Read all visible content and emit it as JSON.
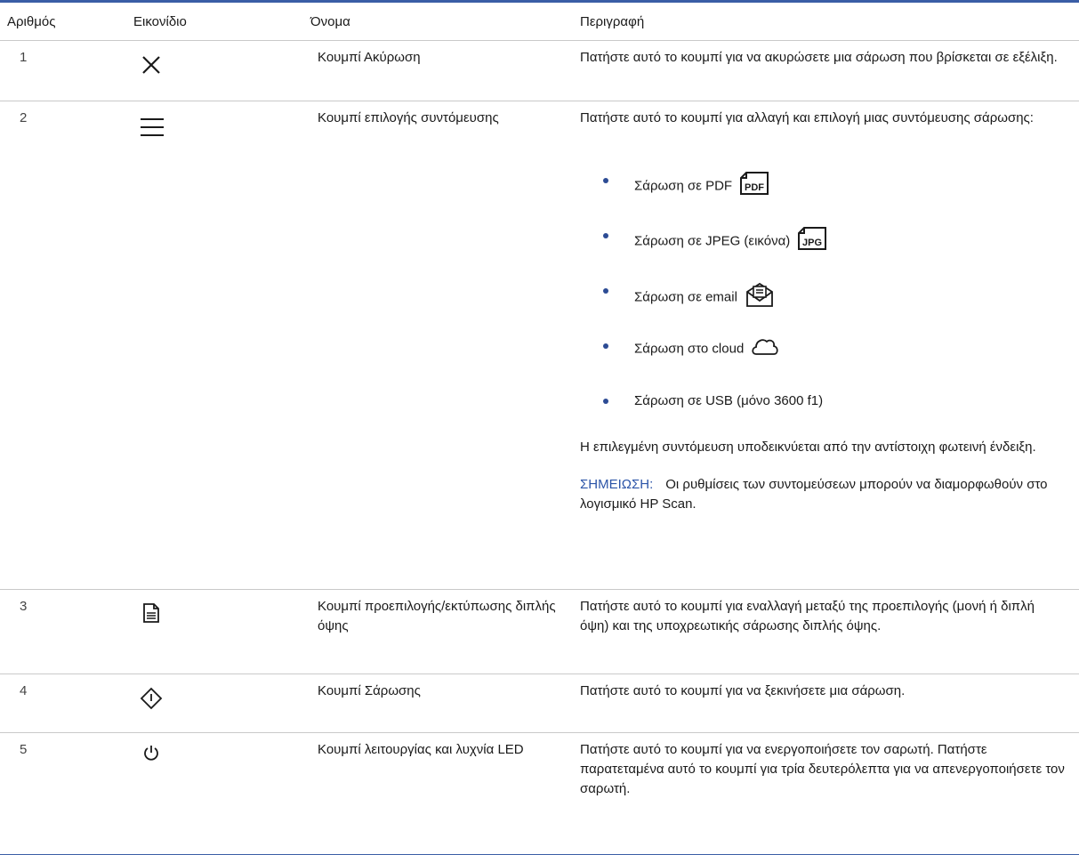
{
  "table": {
    "headers": {
      "number": "Αριθμός",
      "icon": "Εικονίδιο",
      "name": "Όνομα",
      "description": "Περιγραφή"
    },
    "rows": [
      {
        "number": "1",
        "icon": "close-icon",
        "name": "Κουμπί Ακύρωση",
        "description": "Πατήστε αυτό το κουμπί για να ακυρώσετε μια σάρωση που βρίσκεται σε εξέλιξη."
      },
      {
        "number": "2",
        "icon": "menu-icon",
        "name": "Κουμπί επιλογής συντόμευσης",
        "description": "Πατήστε αυτό το κουμπί για αλλαγή και επιλογή μιας συντόμευσης σάρωσης:",
        "bullets": [
          {
            "text": "Σάρωση σε PDF",
            "icon": "pdf-file-icon",
            "icon_label": "PDF"
          },
          {
            "text": "Σάρωση σε JPEG (εικόνα)",
            "icon": "jpg-file-icon",
            "icon_label": "JPG"
          },
          {
            "text": "Σάρωση σε email",
            "icon": "email-icon"
          },
          {
            "text": "Σάρωση στο cloud",
            "icon": "cloud-icon"
          },
          {
            "text": "Σάρωση σε USB (μόνο 3600 f1)"
          }
        ],
        "after": "Η επιλεγμένη συντόμευση υποδεικνύεται από την αντίστοιχη φωτεινή ένδειξη.",
        "note_label": "ΣΗΜΕΙΩΣΗ:",
        "note_text": "Οι ρυθμίσεις των συντομεύσεων μπορούν να διαμορφωθούν στο λογισμικό HP Scan."
      },
      {
        "number": "3",
        "icon": "duplex-document-icon",
        "name": "Κουμπί προεπιλογής/εκτύπωσης διπλής όψης",
        "description": "Πατήστε αυτό το κουμπί για εναλλαγή μεταξύ της προεπιλογής (μονή ή διπλή όψη) και της υποχρεωτικής σάρωσης διπλής όψης."
      },
      {
        "number": "4",
        "icon": "scan-start-icon",
        "name": "Κουμπί Σάρωσης",
        "description": "Πατήστε αυτό το κουμπί για να ξεκινήσετε μια σάρωση."
      },
      {
        "number": "5",
        "icon": "power-icon",
        "name": "Κουμπί λειτουργίας και λυχνία LED",
        "description": "Πατήστε αυτό το κουμπί για να ενεργοποιήσετε τον σαρωτή. Πατήστε παρατεταμένα αυτό το κουμπί για τρία δευτερόλεπτα για να απενεργοποιήσετε τον σαρωτή."
      }
    ]
  },
  "colors": {
    "accent": "#3a5ea6",
    "note_label": "#2c55a8",
    "bullet": "#2c4b94",
    "rule": "#c9c9c9"
  }
}
